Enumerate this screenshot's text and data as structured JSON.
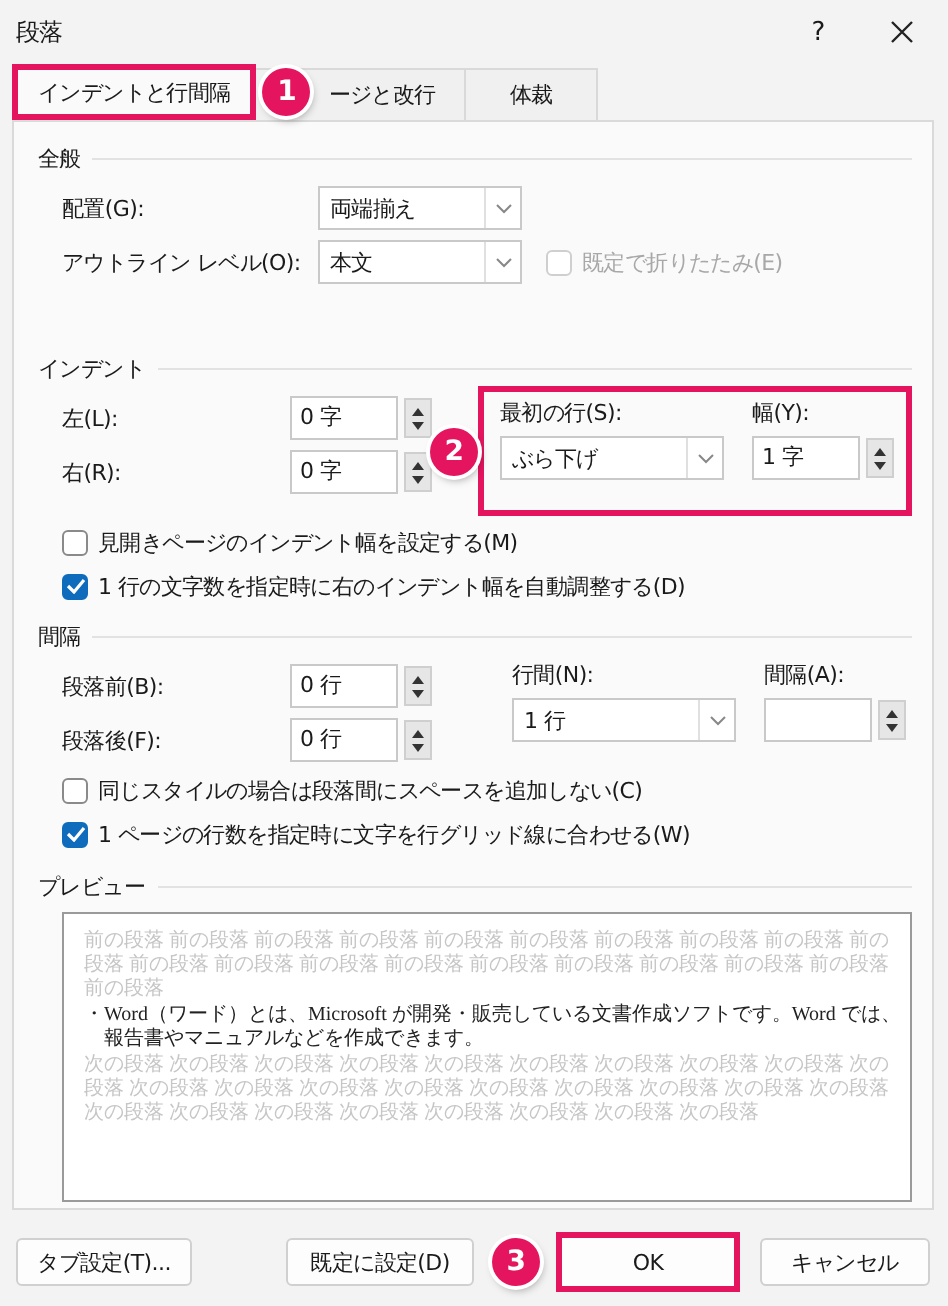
{
  "window": {
    "title": "段落",
    "help": "?"
  },
  "tabs": [
    {
      "label": "インデントと行間隔",
      "selected": true,
      "highlighted": true,
      "marker": "1"
    },
    {
      "label": "ージと改行",
      "selected": false,
      "highlighted": false
    },
    {
      "label": "体裁",
      "selected": false,
      "highlighted": false
    }
  ],
  "general": {
    "heading": "全般",
    "fields": [
      {
        "kind": "dropdown",
        "label": "配置(G):",
        "value": "両端揃え"
      },
      {
        "kind": "dropdown",
        "label": "アウトライン レベル(O):",
        "value": "本文",
        "checkbox": {
          "label": "既定で折りたたみ(E)",
          "checked": false,
          "disabled": true
        }
      }
    ]
  },
  "indent": {
    "heading": "インデント",
    "fields": [
      {
        "kind": "spinner",
        "label": "左(L):",
        "value": "0 字"
      },
      {
        "kind": "spinner",
        "label": "右(R):",
        "value": "0 字"
      }
    ],
    "side": {
      "highlighted": true,
      "marker": "2",
      "fields": [
        {
          "kind": "dropdown",
          "label": "最初の行(S):",
          "value": "ぶら下げ"
        },
        {
          "kind": "spinner",
          "label": "幅(Y):",
          "value": "1 字"
        }
      ]
    },
    "options": [
      {
        "label": "見開きページのインデント幅を設定する(M)",
        "checked": false,
        "disabled": false
      },
      {
        "label": "1 行の文字数を指定時に右のインデント幅を自動調整する(D)",
        "checked": true,
        "disabled": false
      }
    ]
  },
  "spacing": {
    "heading": "間隔",
    "fields": [
      {
        "kind": "spinner",
        "label": "段落前(B):",
        "value": "0 行"
      },
      {
        "kind": "spinner",
        "label": "段落後(F):",
        "value": "0 行"
      }
    ],
    "side": {
      "fields": [
        {
          "kind": "dropdown",
          "label": "行間(N):",
          "value": "1 行"
        },
        {
          "kind": "spinner",
          "label": "間隔(A):"
        }
      ]
    },
    "options": [
      {
        "label": "同じスタイルの場合は段落間にスペースを追加しない(C)",
        "checked": false,
        "disabled": false
      },
      {
        "label": "1 ページの行数を指定時に文字を行グリッド線に合わせる(W)",
        "checked": true,
        "disabled": false
      }
    ]
  },
  "preview": {
    "heading": "プレビュー",
    "before": [
      "前の段落 前の段落 前の段落 前の段落 前の段落 前の段落 前の段落 前の段落 前の段落 前の",
      "段落 前の段落 前の段落 前の段落 前の段落 前の段落 前の段落 前の段落 前の段落 前の段落",
      "前の段落"
    ],
    "text": "・Word（ワード）とは、Microsoft が開発・販売している文書作成ソフトです。Word では、報告書やマニュアルなどを作成できます。",
    "after": [
      "次の段落 次の段落 次の段落 次の段落 次の段落 次の段落 次の段落 次の段落 次の段落 次の",
      "段落 次の段落 次の段落 次の段落 次の段落 次の段落 次の段落 次の段落 次の段落 次の段落",
      "次の段落 次の段落 次の段落 次の段落 次の段落 次の段落 次の段落 次の段落"
    ]
  },
  "buttons": [
    {
      "label": "タブ設定(T)...",
      "highlighted": false
    },
    {
      "label": "既定に設定(D)",
      "highlighted": false
    },
    {
      "label": "OK",
      "highlighted": true,
      "marker": "3"
    },
    {
      "label": "キャンセル",
      "highlighted": false
    }
  ]
}
